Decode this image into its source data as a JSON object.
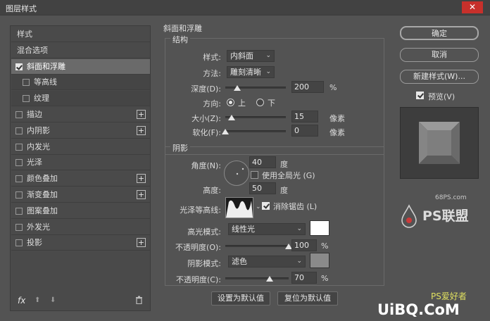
{
  "window": {
    "title": "图层样式",
    "close_label": "✕"
  },
  "sidebar": {
    "items": [
      {
        "label": "样式",
        "type": "plain"
      },
      {
        "label": "混合选项",
        "type": "plain"
      },
      {
        "label": "斜面和浮雕",
        "type": "check",
        "checked": true,
        "selected": true
      },
      {
        "label": "等高线",
        "type": "sub",
        "checked": false
      },
      {
        "label": "纹理",
        "type": "sub",
        "checked": false
      },
      {
        "label": "描边",
        "type": "check",
        "checked": false,
        "plus": true
      },
      {
        "label": "内阴影",
        "type": "check",
        "checked": false,
        "plus": true
      },
      {
        "label": "内发光",
        "type": "check",
        "checked": false
      },
      {
        "label": "光泽",
        "type": "check",
        "checked": false
      },
      {
        "label": "颜色叠加",
        "type": "check",
        "checked": false,
        "plus": true
      },
      {
        "label": "渐变叠加",
        "type": "check",
        "checked": false,
        "plus": true
      },
      {
        "label": "图案叠加",
        "type": "check",
        "checked": false
      },
      {
        "label": "外发光",
        "type": "check",
        "checked": false
      },
      {
        "label": "投影",
        "type": "check",
        "checked": false,
        "plus": true
      }
    ],
    "plus_label": "+",
    "fx_label": "fx",
    "up_label": "⬆",
    "down_label": "⬇",
    "trash_label": "🗑"
  },
  "bevel": {
    "section_title": "斜面和浮雕",
    "structure": {
      "title": "结构",
      "style_label": "样式:",
      "style_value": "内斜面",
      "technique_label": "方法:",
      "technique_value": "雕刻清晰",
      "depth_label": "深度(D):",
      "depth_value": "200",
      "depth_unit": "%",
      "depth_level": 0.2,
      "direction_label": "方向:",
      "direction_up": "上",
      "direction_down": "下",
      "size_label": "大小(Z):",
      "size_value": "15",
      "size_unit": "像素",
      "size_level": 0.1,
      "soften_label": "软化(F):",
      "soften_value": "0",
      "soften_unit": "像素",
      "soften_level": 0.0
    },
    "shading": {
      "title": "阴影",
      "angle_label": "角度(N):",
      "angle_value": "40",
      "angle_unit": "度",
      "global_light_label": "使用全局光 (G)",
      "global_light_checked": false,
      "altitude_label": "高度:",
      "altitude_value": "50",
      "altitude_unit": "度",
      "gloss_contour_label": "光泽等高线:",
      "antialias_label": "消除锯齿 (L)",
      "antialias_checked": true,
      "highlight_mode_label": "高光模式:",
      "highlight_mode_value": "线性光",
      "highlight_color": "#ffffff",
      "highlight_opacity_label": "不透明度(O):",
      "highlight_opacity_value": "100",
      "highlight_opacity_level": 1.0,
      "shadow_mode_label": "阴影模式:",
      "shadow_mode_value": "滤色",
      "shadow_color": "#8a8a8a",
      "shadow_opacity_label": "不透明度(C):",
      "shadow_opacity_value": "70",
      "shadow_opacity_level": 0.7,
      "percent_unit": "%"
    },
    "make_default_label": "设置为默认值",
    "reset_default_label": "复位为默认值"
  },
  "actions": {
    "ok_label": "确定",
    "cancel_label": "取消",
    "new_style_label": "新建样式(W)...",
    "preview_label": "预览(V)",
    "preview_checked": true
  },
  "watermarks": {
    "site1": "68PS.com",
    "brand1": "PS联盟",
    "site2": "UiBQ.CoM",
    "brand2": "PS爱好者"
  }
}
